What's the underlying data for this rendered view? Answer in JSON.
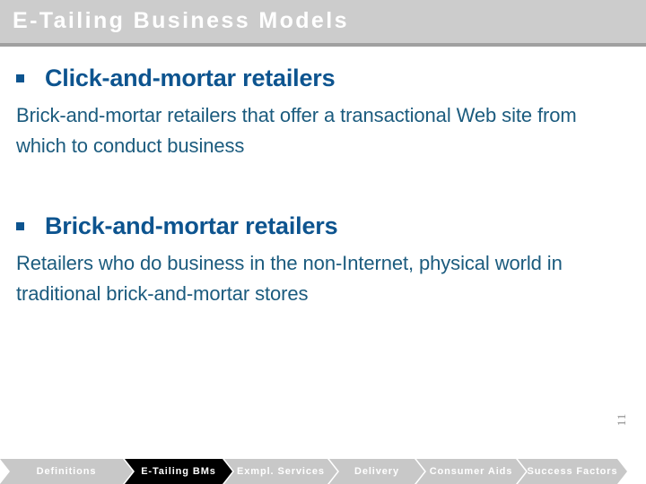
{
  "slide": {
    "title": "E-Tailing Business Models",
    "page_number": "11",
    "colors": {
      "header_bg": "#cccccc",
      "header_rule": "#a0a0a0",
      "title_text": "#ffffff",
      "heading_blue": "#0d548f",
      "body_blue": "#1b5b7e",
      "tab_bg": "#c8c8c8",
      "tab_active_bg": "#000000",
      "tab_text": "#ffffff",
      "background": "#ffffff"
    }
  },
  "content": {
    "blocks": [
      {
        "bullet": "square-bullet",
        "heading": "Click-and-mortar retailers",
        "body": "Brick-and-mortar retailers that offer a transactional Web site from which to conduct business"
      },
      {
        "bullet": "square-bullet",
        "heading": "Brick-and-mortar retailers",
        "body": "Retailers who do business in the non-Internet, physical world in traditional brick-and-mortar stores"
      }
    ]
  },
  "footer": {
    "tabs": [
      {
        "label": "Definitions",
        "active": false
      },
      {
        "label": "E-Tailing BMs",
        "active": true
      },
      {
        "label": "Exmpl. Services",
        "active": false
      },
      {
        "label": "Delivery",
        "active": false
      },
      {
        "label": "Consumer Aids",
        "active": false
      },
      {
        "label": "Success Factors",
        "active": false
      }
    ]
  }
}
